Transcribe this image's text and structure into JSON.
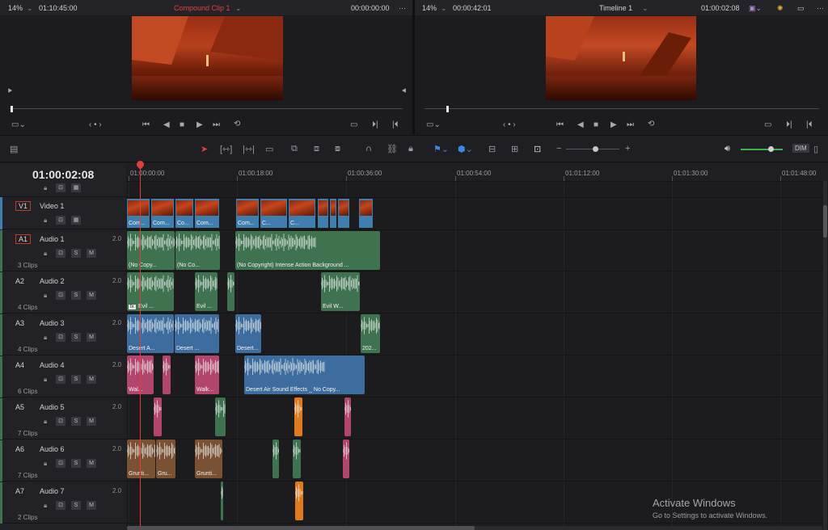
{
  "source_viewer": {
    "zoom": "14%",
    "source_tc": "01:10:45:00",
    "title": "Compound Clip 1",
    "duration": "00:00:00:00"
  },
  "timeline_viewer": {
    "zoom": "14%",
    "duration": "00:00:42:01",
    "title": "Timeline 1",
    "timecode": "01:00:02:08"
  },
  "timeline": {
    "timecode": "01:00:02:08",
    "ruler": [
      "01:00:00:00",
      "01:00:18:00",
      "01:00:36:00",
      "01:00:54:00",
      "01:01:12:00",
      "01:01:30:00",
      "01:01:48:00"
    ]
  },
  "toolbar": {
    "dim_label": "DIM"
  },
  "tracks": [
    {
      "id": "V1",
      "name": "Video 1",
      "volume": "",
      "clips": ""
    },
    {
      "id": "A1",
      "name": "Audio 1",
      "volume": "2.0",
      "clips": "3 Clips"
    },
    {
      "id": "A2",
      "name": "Audio 2",
      "volume": "2.0",
      "clips": "4 Clips"
    },
    {
      "id": "A3",
      "name": "Audio 3",
      "volume": "2.0",
      "clips": "4 Clips"
    },
    {
      "id": "A4",
      "name": "Audio 4",
      "volume": "2.0",
      "clips": "6 Clips"
    },
    {
      "id": "A5",
      "name": "Audio 5",
      "volume": "2.0",
      "clips": "7 Clips"
    },
    {
      "id": "A6",
      "name": "Audio 6",
      "volume": "2.0",
      "clips": "7 Clips"
    },
    {
      "id": "A7",
      "name": "Audio 7",
      "volume": "2.0",
      "clips": "2 Clips"
    }
  ],
  "video_clips": [
    "Com...",
    "Com...",
    "Co...",
    "Com...",
    "Com...",
    "C...",
    "C...",
    "",
    "",
    "",
    ""
  ],
  "audio_clip_labels": {
    "a1": [
      "(No Copy...",
      "(No Co...",
      "(No Copyright) Intense Action Background ..."
    ],
    "a2": [
      "Evil ...",
      "Evil ...",
      "Evil W..."
    ],
    "a3": [
      "Desert A...",
      "Desert ...",
      "Desert...",
      "202..."
    ],
    "a4": [
      "Wal...",
      "Walk...",
      "Desert Air Sound Effects _ No Copy..."
    ],
    "a6": [
      "Grunti...",
      "Gru...",
      "Grunti..."
    ]
  },
  "badges": {
    "fx": "fx"
  },
  "track_buttons": {
    "solo": "S",
    "mute": "M"
  },
  "watermark": {
    "title": "Activate Windows",
    "subtitle": "Go to Settings to activate Windows."
  },
  "colors": {
    "audio_green": "#3f7350",
    "audio_blue": "#3d6d9e",
    "audio_pink": "#b2456e",
    "audio_brown": "#7a5132",
    "audio_orange": "#e07a1f",
    "video_blue": "#3f7fb0",
    "playhead": "#e0403a"
  }
}
